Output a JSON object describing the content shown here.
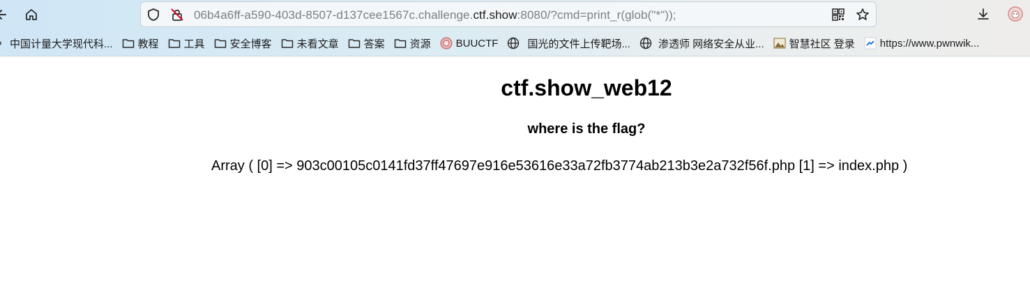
{
  "browser": {
    "url": {
      "prefix": "06b4a6ff-a590-403d-8507-d137cee1567c.challenge.",
      "domain": "ctf.show",
      "suffix": ":8080/?cmd=print_r(glob(\"*\"));"
    },
    "icons": {
      "back": "back-arrow-icon",
      "home": "home-icon",
      "shield": "tracking-shield-icon",
      "insecure": "insecure-lock-icon",
      "qr": "qr-code-icon",
      "star": "bookmark-star-icon",
      "download": "download-icon",
      "profile": "profile-avatar-icon"
    }
  },
  "bookmarks": [
    {
      "label": "中国计量大学现代科...",
      "icon": "none"
    },
    {
      "label": "教程",
      "icon": "folder-icon"
    },
    {
      "label": "工具",
      "icon": "folder-icon"
    },
    {
      "label": "安全博客",
      "icon": "folder-icon"
    },
    {
      "label": "未看文章",
      "icon": "folder-icon"
    },
    {
      "label": "答案",
      "icon": "folder-icon"
    },
    {
      "label": "资源",
      "icon": "folder-icon"
    },
    {
      "label": "BUUCTF",
      "icon": "buuctf-logo-icon"
    },
    {
      "label": "国光的文件上传靶场...",
      "icon": "globe-icon"
    },
    {
      "label": "渗透师 网络安全从业...",
      "icon": "globe-icon"
    },
    {
      "label": "智慧社区 登录",
      "icon": "picture-icon"
    },
    {
      "label": "https://www.pwnwik...",
      "icon": "link-icon"
    }
  ],
  "page": {
    "title": "ctf.show_web12",
    "subtitle": "where is the flag?",
    "output": "Array ( [0] => 903c00105c0141fd37ff47697e916e53616e33a72fb3774ab213b3e2a732f56f.php [1] => index.php )"
  },
  "colors": {
    "chrome_start": "#cfe6f6",
    "chrome_end": "#eeedeb",
    "url_muted": "#7a7f85",
    "url_domain": "#1c1c1c"
  }
}
